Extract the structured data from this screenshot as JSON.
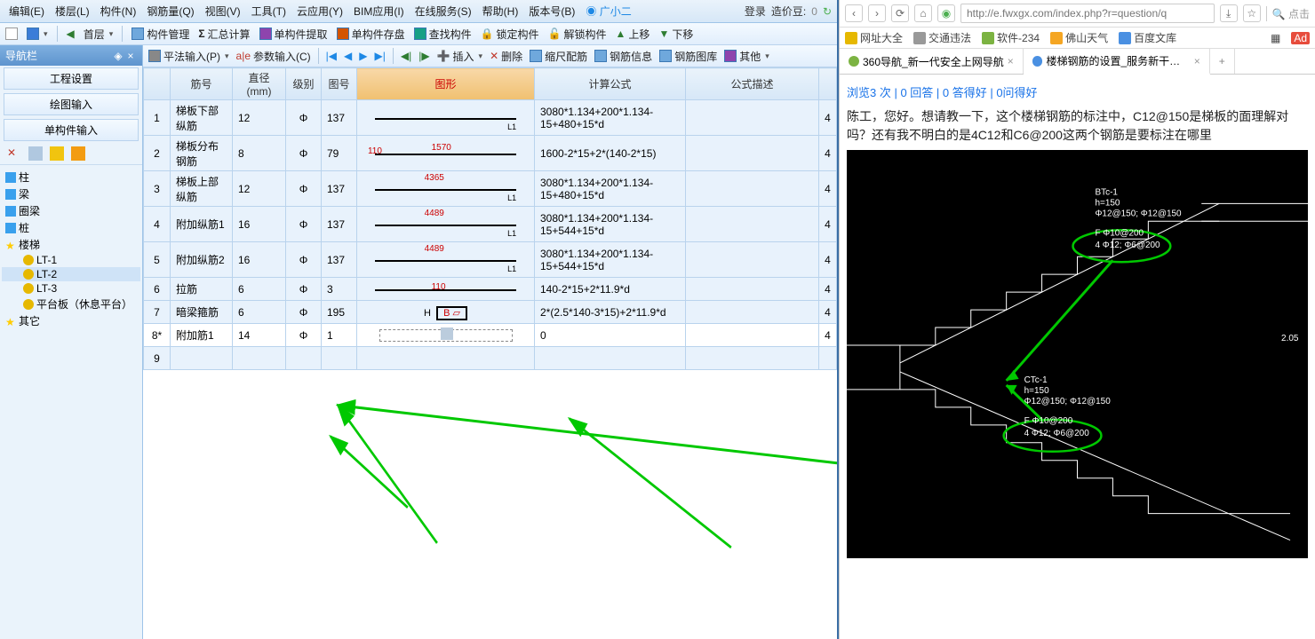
{
  "app": {
    "menu_items": [
      "编辑(E)",
      "楼层(L)",
      "构件(N)",
      "钢筋量(Q)",
      "视图(V)",
      "工具(T)",
      "云应用(Y)",
      "BIM应用(I)",
      "在线服务(S)",
      "帮助(H)",
      "版本号(B)"
    ],
    "broadcast_icon": "广小二",
    "login": "登录",
    "credits_label": "造价豆:",
    "credits_value": "0",
    "toolbar1": {
      "floor": "首层",
      "items": [
        "构件管理",
        "汇总计算",
        "单构件提取",
        "单构件存盘",
        "查找构件",
        "锁定构件",
        "解锁构件",
        "上移",
        "下移"
      ]
    },
    "table_toolbar": {
      "input_mode": "平法输入(P)",
      "param_input": "参数输入(C)",
      "insert": "插入",
      "delete": "删除",
      "scale": "缩尺配筋",
      "info": "钢筋信息",
      "library": "钢筋图库",
      "other": "其他"
    },
    "nav": {
      "title": "导航栏",
      "buttons": [
        "工程设置",
        "绘图输入",
        "单构件输入"
      ],
      "tree_roots": [
        {
          "label": "柱",
          "icon": "bar"
        },
        {
          "label": "梁",
          "icon": "bar"
        },
        {
          "label": "圈梁",
          "icon": "bar"
        },
        {
          "label": "桩",
          "icon": "bar"
        },
        {
          "label": "楼梯",
          "icon": "star",
          "children": [
            {
              "label": "LT-1"
            },
            {
              "label": "LT-2",
              "selected": true
            },
            {
              "label": "LT-3"
            },
            {
              "label": "平台板（休息平台）"
            }
          ]
        },
        {
          "label": "其它",
          "icon": "star"
        }
      ]
    },
    "columns": [
      "",
      "筋号",
      "直径(mm)",
      "级别",
      "图号",
      "图形",
      "计算公式",
      "公式描述",
      ""
    ],
    "rows": [
      {
        "n": "1",
        "name": "梯板下部纵筋",
        "dia": "12",
        "lvl": "Φ",
        "img": "137",
        "shape": "L-H-L1",
        "formula": "3080*1.134+200*1.134-15+480+15*d",
        "desc": ""
      },
      {
        "n": "2",
        "name": "梯板分布钢筋",
        "dia": "8",
        "lvl": "Φ",
        "img": "79",
        "shape_label_l": "110",
        "shape_label_c": "1570",
        "formula": "1600-2*15+2*(140-2*15)",
        "desc": ""
      },
      {
        "n": "3",
        "name": "梯板上部纵筋",
        "dia": "12",
        "lvl": "Φ",
        "img": "137",
        "shape_top": "4365",
        "shape": "H-B-L1",
        "formula": "3080*1.134+200*1.134-15+480+15*d",
        "desc": ""
      },
      {
        "n": "4",
        "name": "附加纵筋1",
        "dia": "16",
        "lvl": "Φ",
        "img": "137",
        "shape_top": "4489",
        "shape": "H-B-L1",
        "formula": "3080*1.134+200*1.134-15+544+15*d",
        "desc": ""
      },
      {
        "n": "5",
        "name": "附加纵筋2",
        "dia": "16",
        "lvl": "Φ",
        "img": "137",
        "shape_top": "4489",
        "shape": "H-B-L1",
        "formula": "3080*1.134+200*1.134-15+544+15*d",
        "desc": ""
      },
      {
        "n": "6",
        "name": "拉筋",
        "dia": "6",
        "lvl": "Φ",
        "img": "3",
        "shape_label_c": "110",
        "formula": "140-2*15+2*11.9*d",
        "desc": "",
        "short": true
      },
      {
        "n": "7",
        "name": "暗梁箍筋",
        "dia": "6",
        "lvl": "Φ",
        "img": "195",
        "shape_mark": "H B",
        "formula": "2*(2.5*140-3*15)+2*11.9*d",
        "desc": "",
        "short": true
      },
      {
        "n": "8*",
        "name": "附加筋1",
        "dia": "14",
        "lvl": "Φ",
        "img": "1",
        "shape_edit": true,
        "formula": "0",
        "desc": "",
        "active": true,
        "short": true
      },
      {
        "n": "9",
        "name": "",
        "dia": "",
        "lvl": "",
        "img": "",
        "formula": "",
        "desc": "",
        "short": true
      }
    ]
  },
  "browser": {
    "url": "http://e.fwxgx.com/index.php?r=question/q",
    "url_hint": "点击",
    "bookmarks": [
      {
        "label": "网址大全",
        "color": "#e6b800"
      },
      {
        "label": "交通违法",
        "color": "#999"
      },
      {
        "label": "软件-234",
        "color": "#7cb342"
      },
      {
        "label": "佛山天气",
        "color": "#f5a623"
      },
      {
        "label": "百度文库",
        "color": "#4a90e2"
      }
    ],
    "tabs": [
      {
        "label": "360导航_新一代安全上网导航",
        "fav": "#7cb342"
      },
      {
        "label": "楼梯钢筋的设置_服务新干线|同",
        "fav": "#4a90e2",
        "active": true
      }
    ],
    "meta": "浏览3 次 | 0 回答 | 0 答得好 | 0问得好",
    "question": "陈工，您好。想请教一下，这个楼梯钢筋的标注中，C12@150是梯板的面理解对吗？还有我不明白的是4C12和C6@200这两个钢筋是要标注在哪里",
    "cad_labels": {
      "t1_title": "BTc-1",
      "t1_h": "h=150",
      "t1_a": "Φ12@150; Φ12@150",
      "t1_b": "F Φ10@200",
      "t1_c": "4 Φ12; Φ6@200",
      "t2_title": "CTc-1",
      "t2_h": "h=150",
      "t2_a": "Φ12@150; Φ12@150",
      "t2_b": "F Φ10@200",
      "t2_c": "4 Φ12; Φ6@200",
      "dim": "2.05"
    }
  }
}
